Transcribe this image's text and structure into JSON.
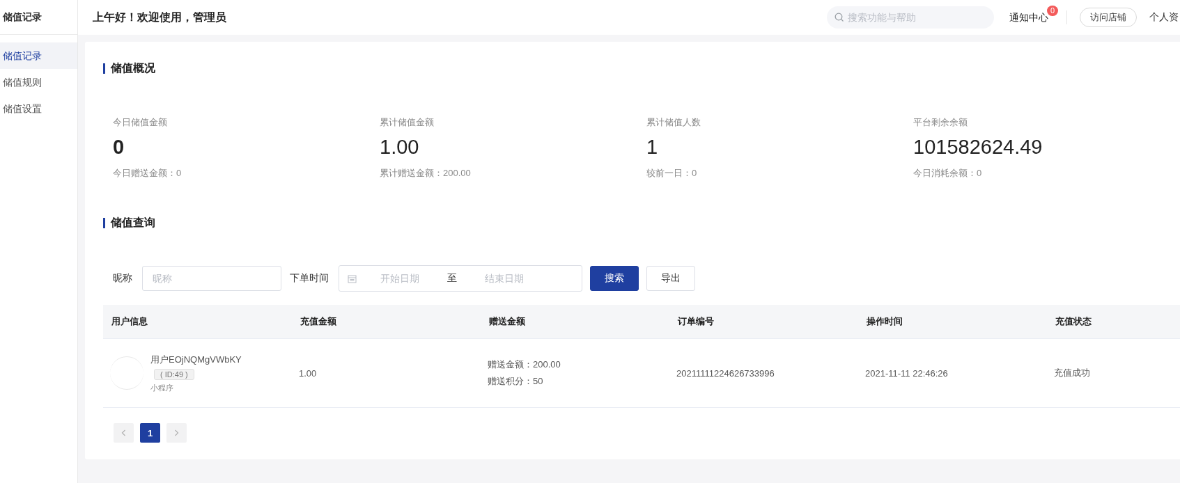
{
  "sidebar": {
    "title": "储值记录",
    "items": [
      {
        "label": "储值记录",
        "selected": true
      },
      {
        "label": "储值规则",
        "selected": false
      },
      {
        "label": "储值设置",
        "selected": false
      }
    ]
  },
  "header": {
    "greeting": "上午好！欢迎使用，管理员",
    "search": {
      "placeholder": "搜索功能与帮助"
    },
    "notifications": {
      "label": "通知中心",
      "count": "0"
    },
    "visit_button": "访问店铺",
    "profile": "个人资"
  },
  "overview": {
    "title": "储值概况",
    "stats": [
      {
        "label": "今日储值金额",
        "value": "0",
        "note": "今日赠送金额：0",
        "bold": true
      },
      {
        "label": "累计储值金额",
        "value": "1.00",
        "note": "累计赠送金额：200.00",
        "bold": false
      },
      {
        "label": "累计储值人数",
        "value": "1",
        "note": "较前一日：0",
        "bold": false
      },
      {
        "label": "平台剩余余额",
        "value": "101582624.49",
        "note": "今日消耗余额：0",
        "bold": false
      }
    ]
  },
  "query": {
    "title": "储值查询",
    "nickname_label": "昵称",
    "nickname": {
      "placeholder": "昵称"
    },
    "time_label": "下单时间",
    "start": {
      "placeholder": "开始日期"
    },
    "separator": "至",
    "end": {
      "placeholder": "结束日期"
    },
    "search_button": "搜索",
    "export_button": "导出"
  },
  "table": {
    "columns": [
      "用户信息",
      "充值金额",
      "赠送金额",
      "订单编号",
      "操作时间",
      "充值状态"
    ],
    "rows": [
      {
        "user_name": "用户EOjNQMgVWbKY",
        "user_id": "( ID:49 )",
        "source": "小程序",
        "amount": "1.00",
        "bonus": [
          "赠送金额：200.00",
          "赠送积分：50"
        ],
        "order_no": "20211111224626733996",
        "time": "2021-11-11 22:46:26",
        "status": "充值成功"
      }
    ]
  },
  "pagination": {
    "pages": [
      {
        "label": "1",
        "selected": true
      }
    ]
  }
}
